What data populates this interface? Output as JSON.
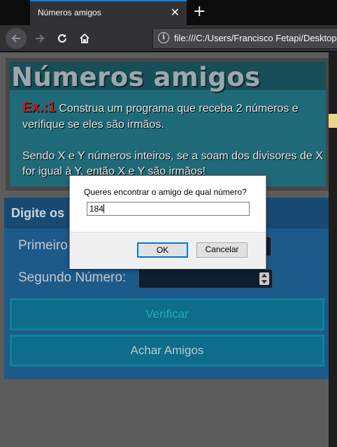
{
  "browser": {
    "tab_title": "Números amigos",
    "tab_close": "✕",
    "new_tab": "+",
    "url": "file:///C:/Users/Francisco Fetapi/Desktop",
    "icons": {
      "back": "arrow-left-icon",
      "forward": "arrow-right-icon",
      "reload": "reload-icon",
      "home": "home-icon",
      "info": "info-icon"
    }
  },
  "page": {
    "title": "Números amigos",
    "exercise_label": "Ex.:1",
    "exercise_text": " Construa um programa que receba 2 números e verifique se eles são irmãos.",
    "description": "Sendo X e Y números inteiros, se a soam dos divisores de X for igual à Y, então X e Y são irmãos!",
    "form_heading": "Digite os",
    "first_label": "Primeiro",
    "second_label": "Segundo Número:",
    "verify_button": "Verificar",
    "friends_button": "Achar Amigos"
  },
  "dialog": {
    "message": "Queres encontrar o amigo de qual número?",
    "input_value": "184",
    "ok_label": "OK",
    "cancel_label": "Cancelar"
  },
  "colors": {
    "accent": "#0a84ff",
    "exercise_label": "#c41a1a",
    "header_teal": "#1f6a78",
    "form_blue": "#1c5a8a"
  }
}
